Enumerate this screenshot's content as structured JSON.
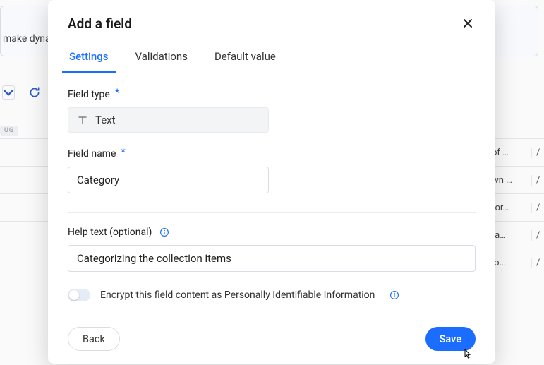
{
  "background": {
    "banner_fragment": "make dyna",
    "tag": "UG",
    "rows": [
      {
        "a": "of …",
        "b": "/"
      },
      {
        "a": "wn …",
        "b": "/"
      },
      {
        "a": "for…",
        "b": "/"
      },
      {
        "a": "ra…",
        "b": "/"
      },
      {
        "a": "lo…",
        "b": "/"
      }
    ]
  },
  "modal": {
    "title": "Add a field",
    "tabs": [
      {
        "label": "Settings",
        "active": true
      },
      {
        "label": "Validations",
        "active": false
      },
      {
        "label": "Default value",
        "active": false
      }
    ],
    "field_type": {
      "label": "Field type",
      "value": "Text"
    },
    "field_name": {
      "label": "Field name",
      "value": "Category"
    },
    "help_text": {
      "label": "Help text (optional)",
      "value": "Categorizing the collection items"
    },
    "encrypt_label": "Encrypt this field content as Personally Identifiable Information",
    "encrypt_on": false,
    "buttons": {
      "back": "Back",
      "save": "Save"
    }
  }
}
